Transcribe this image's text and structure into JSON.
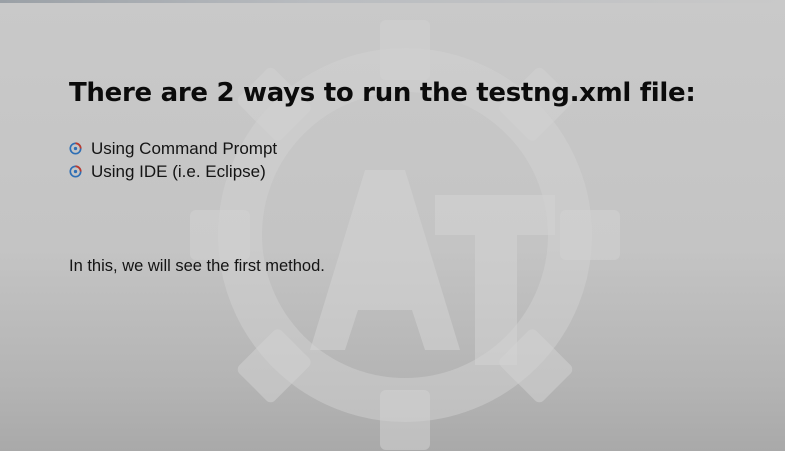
{
  "slide": {
    "title": "There are 2 ways to run the testng.xml file:",
    "bullets": [
      {
        "label": "Using Command Prompt",
        "icon": "swirl-bullet-icon"
      },
      {
        "label": "Using IDE (i.e. Eclipse)",
        "icon": "swirl-bullet-icon"
      }
    ],
    "note": "In this, we will see the first method."
  },
  "colors": {
    "background": "#c4c4c4",
    "text": "#0b0b0b",
    "bullet_red": "#c0392b",
    "bullet_blue": "#2e6fb5"
  }
}
